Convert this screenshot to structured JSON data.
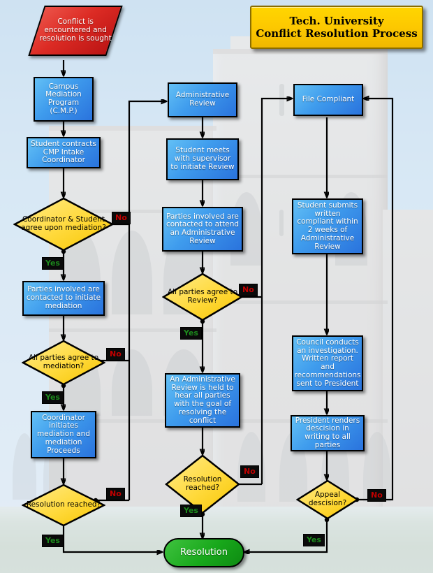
{
  "title": {
    "line1": "Tech. University",
    "line2": "Conflict Resolution Process"
  },
  "colors": {
    "process_fill": "#2a73dd",
    "decision_fill": "#ffd21e",
    "start_fill": "#c41a1a",
    "terminator_fill": "#18a81b",
    "title_fill": "#fdc800",
    "yes_label": "#1d8a1d",
    "no_label": "#c00000",
    "edge": "#000000"
  },
  "nodes": {
    "start": "Conflict is encountered and resolution is sought",
    "cmp": "Campus Mediation Program (C.M.P.)",
    "intake": "Student contracts CMP Intake Coordinator",
    "d_coord_student": "Coordinator & Student agree upon mediation?",
    "parties_mediation": "Parties involved are contacted to initiate mediation",
    "d_all_mediation": "All parties agree to mediation?",
    "coord_initiates": "Coordinator initiates mediation and mediation Proceeds",
    "d_res_left": "Resolution reached?",
    "admin_review": "Administrative Review",
    "student_supervisor": "Student meets with supervisor to initiate Review",
    "parties_admin": "Parties involved are contacted to attend an Administrative Review",
    "d_all_review": "All parties agree to Review?",
    "admin_held": "An Administrative Review is held to hear all parties with the goal of resolving the conflict",
    "d_res_mid": "Resolution reached?",
    "file_compliant": "File Compliant",
    "student_submits": "Student submits written compliant within 2 weeks of Administrative Review",
    "council": "Council conducts an investigation. Written report and recommendations sent to President",
    "president": "President renders descision in writing to all parties",
    "d_appeal": "Appeal descision?",
    "resolution": "Resolution"
  },
  "edge_labels": {
    "no": "No",
    "yes": "Yes"
  },
  "chart_data": {
    "type": "diagram",
    "title": "Tech. University Conflict Resolution Process",
    "shapes": [
      {
        "id": "start",
        "kind": "parallelogram",
        "label": "Conflict is encountered and resolution is sought",
        "color": "#c41a1a"
      },
      {
        "id": "cmp",
        "kind": "process",
        "label": "Campus Mediation Program (C.M.P.)",
        "color": "#2a73dd"
      },
      {
        "id": "intake",
        "kind": "process",
        "label": "Student contracts CMP Intake Coordinator",
        "color": "#2a73dd"
      },
      {
        "id": "d_coord_student",
        "kind": "decision",
        "label": "Coordinator & Student agree upon mediation?",
        "color": "#ffd21e"
      },
      {
        "id": "parties_mediation",
        "kind": "process",
        "label": "Parties involved are contacted to initiate mediation",
        "color": "#2a73dd"
      },
      {
        "id": "d_all_mediation",
        "kind": "decision",
        "label": "All parties agree to mediation?",
        "color": "#ffd21e"
      },
      {
        "id": "coord_initiates",
        "kind": "process",
        "label": "Coordinator initiates mediation and mediation Proceeds",
        "color": "#2a73dd"
      },
      {
        "id": "d_res_left",
        "kind": "decision",
        "label": "Resolution reached?",
        "color": "#ffd21e"
      },
      {
        "id": "admin_review",
        "kind": "process",
        "label": "Administrative Review",
        "color": "#2a73dd"
      },
      {
        "id": "student_supervisor",
        "kind": "process",
        "label": "Student meets with supervisor to initiate Review",
        "color": "#2a73dd"
      },
      {
        "id": "parties_admin",
        "kind": "process",
        "label": "Parties involved are contacted to attend an Administrative Review",
        "color": "#2a73dd"
      },
      {
        "id": "d_all_review",
        "kind": "decision",
        "label": "All parties agree to Review?",
        "color": "#ffd21e"
      },
      {
        "id": "admin_held",
        "kind": "process",
        "label": "An Administrative Review is held to hear all parties with the goal of resolving the conflict",
        "color": "#2a73dd"
      },
      {
        "id": "d_res_mid",
        "kind": "decision",
        "label": "Resolution reached?",
        "color": "#ffd21e"
      },
      {
        "id": "file_compliant",
        "kind": "process",
        "label": "File Compliant",
        "color": "#2a73dd"
      },
      {
        "id": "student_submits",
        "kind": "process",
        "label": "Student submits written compliant within 2 weeks of Administrative Review",
        "color": "#2a73dd"
      },
      {
        "id": "council",
        "kind": "process",
        "label": "Council conducts an investigation. Written report and recommendations sent to President",
        "color": "#2a73dd"
      },
      {
        "id": "president",
        "kind": "process",
        "label": "President renders descision in writing to all parties",
        "color": "#2a73dd"
      },
      {
        "id": "d_appeal",
        "kind": "decision",
        "label": "Appeal descision?",
        "color": "#ffd21e"
      },
      {
        "id": "resolution",
        "kind": "terminator",
        "label": "Resolution",
        "color": "#18a81b"
      }
    ],
    "edges": [
      {
        "from": "start",
        "to": "cmp",
        "label": ""
      },
      {
        "from": "cmp",
        "to": "intake",
        "label": ""
      },
      {
        "from": "intake",
        "to": "d_coord_student",
        "label": ""
      },
      {
        "from": "d_coord_student",
        "to": "parties_mediation",
        "label": "Yes"
      },
      {
        "from": "d_coord_student",
        "to": "admin_review",
        "label": "No"
      },
      {
        "from": "parties_mediation",
        "to": "d_all_mediation",
        "label": ""
      },
      {
        "from": "d_all_mediation",
        "to": "coord_initiates",
        "label": "Yes"
      },
      {
        "from": "d_all_mediation",
        "to": "admin_review",
        "label": "No"
      },
      {
        "from": "coord_initiates",
        "to": "d_res_left",
        "label": ""
      },
      {
        "from": "d_res_left",
        "to": "resolution",
        "label": "Yes"
      },
      {
        "from": "d_res_left",
        "to": "admin_review",
        "label": "No"
      },
      {
        "from": "admin_review",
        "to": "student_supervisor",
        "label": ""
      },
      {
        "from": "student_supervisor",
        "to": "parties_admin",
        "label": ""
      },
      {
        "from": "parties_admin",
        "to": "d_all_review",
        "label": ""
      },
      {
        "from": "d_all_review",
        "to": "admin_held",
        "label": "Yes"
      },
      {
        "from": "d_all_review",
        "to": "file_compliant",
        "label": "No"
      },
      {
        "from": "admin_held",
        "to": "d_res_mid",
        "label": ""
      },
      {
        "from": "d_res_mid",
        "to": "resolution",
        "label": "Yes"
      },
      {
        "from": "d_res_mid",
        "to": "file_compliant",
        "label": "No"
      },
      {
        "from": "file_compliant",
        "to": "student_submits",
        "label": ""
      },
      {
        "from": "student_submits",
        "to": "council",
        "label": ""
      },
      {
        "from": "council",
        "to": "president",
        "label": ""
      },
      {
        "from": "president",
        "to": "d_appeal",
        "label": ""
      },
      {
        "from": "d_appeal",
        "to": "resolution",
        "label": "Yes"
      },
      {
        "from": "d_appeal",
        "to": "file_compliant",
        "label": "No"
      }
    ]
  }
}
